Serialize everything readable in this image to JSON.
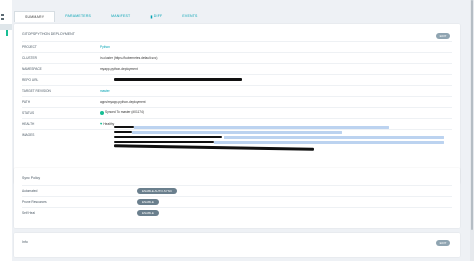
{
  "tabs": [
    {
      "label": "SUMMARY"
    },
    {
      "label": "PARAMETERS"
    },
    {
      "label": "MANIFEST"
    },
    {
      "label": "DIFF"
    },
    {
      "label": "EVENTS"
    }
  ],
  "summary": {
    "title": "GITOPSPYTHON DEPLOYMENT",
    "edit_label": "EDIT",
    "rows": [
      {
        "label": "PROJECT",
        "value": "Python"
      },
      {
        "label": "CLUSTER",
        "value": "in-cluster (https://kubernetes.default.svc)"
      },
      {
        "label": "NAMESPACE",
        "value": "myapp-python-deployment"
      },
      {
        "label": "REPO URL",
        "value": ""
      },
      {
        "label": "TARGET REVISION",
        "value": "master"
      },
      {
        "label": "PATH",
        "value": "apps/myapp-python-deployment"
      },
      {
        "label": "STATUS",
        "value": "Synced To master (#01174)"
      },
      {
        "label": "HEALTH",
        "value": "Healthy"
      },
      {
        "label": "IMAGES",
        "value": ""
      }
    ]
  },
  "sync_policy": {
    "title": "Sync Policy",
    "rows": [
      {
        "label": "Automated",
        "button": "ENABLE AUTO-SYNC"
      },
      {
        "label": "Prune Resources",
        "button": "ENABLE"
      },
      {
        "label": "Self Heal",
        "button": "ENABLE"
      }
    ]
  },
  "info": {
    "title": "Info",
    "edit_label": "EDIT"
  },
  "colors": {
    "accent": "#00a2b3",
    "healthy": "#18be94",
    "button": "#6a7f8d"
  }
}
